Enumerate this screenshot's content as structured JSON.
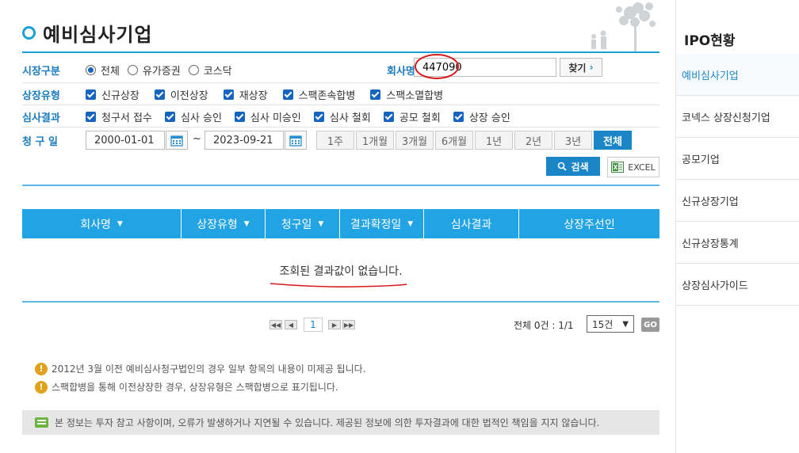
{
  "page_title": "예비심사기업",
  "filters": {
    "market": {
      "label": "시장구분",
      "options": [
        {
          "label": "전체",
          "selected": true
        },
        {
          "label": "유가증권",
          "selected": false
        },
        {
          "label": "코스닥",
          "selected": false
        }
      ]
    },
    "listing_type": {
      "label": "상장유형",
      "options": [
        "신규상장",
        "이전상장",
        "재상장",
        "스팩존속합병",
        "스팩소멸합병"
      ]
    },
    "review_result": {
      "label": "심사결과",
      "options": [
        "청구서 접수",
        "심사 승인",
        "심사 미승인",
        "심사 철회",
        "공모 철회",
        "상장 승인"
      ]
    },
    "claim_date": {
      "label": "청 구 일",
      "from": "2000-01-01",
      "separator": "~",
      "to": "2023-09-21",
      "periods": [
        "1주",
        "1개월",
        "3개월",
        "6개월",
        "1년",
        "2년",
        "3년",
        "전체"
      ],
      "active_period": "전체"
    },
    "company": {
      "label": "회사명",
      "value": "447090",
      "find_label": "찾기",
      "find_arrow": "›"
    }
  },
  "actions": {
    "search_label": "검색",
    "excel_label": "EXCEL"
  },
  "table": {
    "columns": [
      {
        "label": "회사명",
        "sortable": true
      },
      {
        "label": "상장유형",
        "sortable": true
      },
      {
        "label": "청구일",
        "sortable": true
      },
      {
        "label": "결과확정일",
        "sortable": true
      },
      {
        "label": "심사결과",
        "sortable": false
      },
      {
        "label": "상장주선인",
        "sortable": false
      }
    ],
    "empty_message": "조회된 결과값이 없습니다."
  },
  "pagination": {
    "current_page": "1",
    "total_text": "전체 0건 : 1/1",
    "page_size": "15건",
    "go_label": "GO"
  },
  "notes": [
    "2012년 3월 이전 예비심사청구법인의 경우 일부 항목의 내용이 미제공 됩니다.",
    "스팩합병을 통해 이전상장한 경우, 상장유형은 스팩합병으로 표기됩니다."
  ],
  "disclaimer": "본 정보는 투자 참고 사항이며, 오류가 발생하거나 지연될 수 있습니다. 제공된 정보에 의한 투자결과에 대한 법적인 책임을 지지 않습니다.",
  "sidebar": {
    "title": "IPO현황",
    "items": [
      {
        "label": "예비심사기업",
        "active": true
      },
      {
        "label": "코넥스 상장신청기업",
        "active": false
      },
      {
        "label": "공모기업",
        "active": false
      },
      {
        "label": "신규상장기업",
        "active": false
      },
      {
        "label": "신규상장통계",
        "active": false
      },
      {
        "label": "상장심사가이드",
        "active": false
      }
    ]
  },
  "colors": {
    "accent": "#1a86c8",
    "table_header": "#21a3e4",
    "annotation": "#d61a1a",
    "warning": "#e0a21a"
  }
}
